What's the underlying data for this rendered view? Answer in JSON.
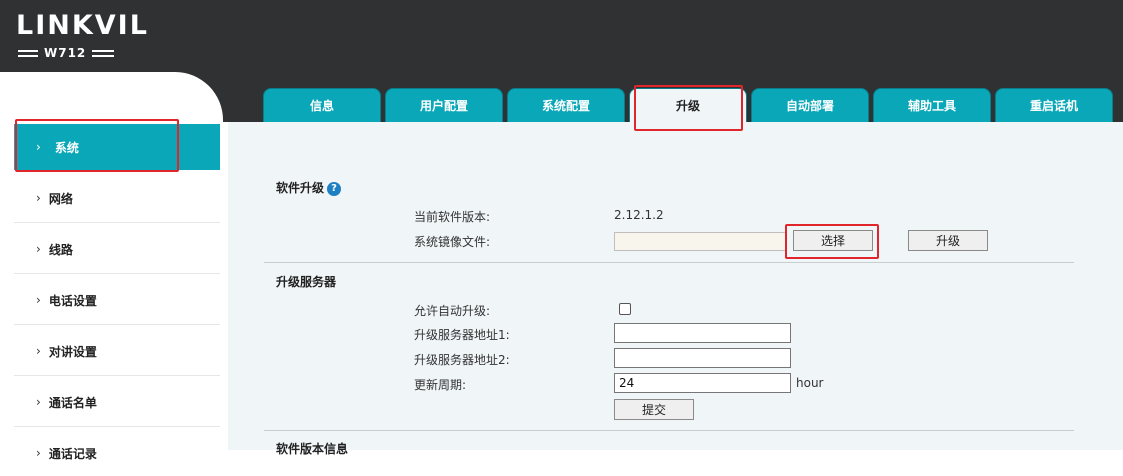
{
  "brand": {
    "logo": "LINKVIL",
    "model": "W712"
  },
  "sidebar": {
    "items": [
      {
        "label": "系统"
      },
      {
        "label": "网络"
      },
      {
        "label": "线路"
      },
      {
        "label": "电话设置"
      },
      {
        "label": "对讲设置"
      },
      {
        "label": "通话名单"
      },
      {
        "label": "通话记录"
      }
    ],
    "chevron": "›"
  },
  "tabs": [
    {
      "label": "信息"
    },
    {
      "label": "用户配置"
    },
    {
      "label": "系统配置"
    },
    {
      "label": "升级"
    },
    {
      "label": "自动部署"
    },
    {
      "label": "辅助工具"
    },
    {
      "label": "重启话机"
    }
  ],
  "upgrade": {
    "section_title": "软件升级",
    "help_icon": "?",
    "current_version_label": "当前软件版本:",
    "current_version": "2.12.1.2",
    "image_file_label": "系统镜像文件:",
    "choose_button": "选择",
    "upgrade_button": "升级"
  },
  "server": {
    "section_title": "升级服务器",
    "auto_upgrade_label": "允许自动升级:",
    "auto_upgrade_checked": false,
    "server1_label": "升级服务器地址1:",
    "server1_value": "",
    "server2_label": "升级服务器地址2:",
    "server2_value": "",
    "period_label": "更新周期:",
    "period_value": "24",
    "period_unit": "hour",
    "submit_button": "提交"
  },
  "version_info": {
    "section_title": "软件版本信息"
  },
  "highlight_color": "#e0262a",
  "accent_color": "#0aa7b8"
}
